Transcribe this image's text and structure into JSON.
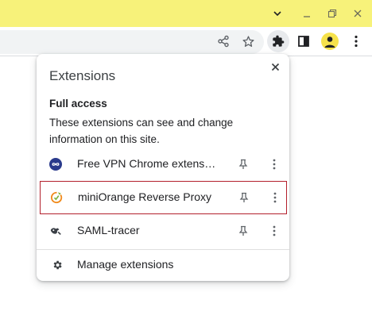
{
  "window": {
    "titlebar_color": "#f7f27a",
    "controls": [
      "chevron-down-icon",
      "minimize-icon",
      "restore-icon",
      "close-icon"
    ]
  },
  "toolbar": {
    "icons": [
      "share-icon",
      "star-icon",
      "extensions-puzzle-icon",
      "side-panel-icon",
      "profile-avatar",
      "more-vert-icon"
    ]
  },
  "extensions_popup": {
    "title": "Extensions",
    "access_heading": "Full access",
    "access_description": "These extensions can see and change information on this site.",
    "items": [
      {
        "name": "Free VPN Chrome extension",
        "icon": "vpn-infinity-icon",
        "highlighted": false
      },
      {
        "name": "miniOrange Reverse Proxy",
        "icon": "miniorange-icon",
        "highlighted": true
      },
      {
        "name": "SAML-tracer",
        "icon": "saml-tracer-icon",
        "highlighted": false
      }
    ],
    "manage_label": "Manage extensions",
    "highlight_color": "#b3202c"
  }
}
